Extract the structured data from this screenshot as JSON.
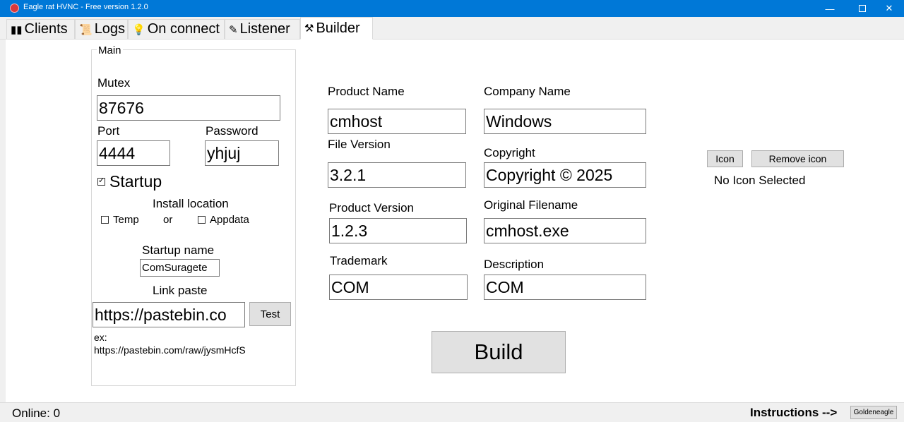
{
  "window": {
    "title": "Eagle rat HVNC - Free version 1.2.0",
    "minimize_glyph": "—",
    "close_glyph": "✕"
  },
  "tabs": [
    {
      "label": "Clients",
      "icon": "▮▮"
    },
    {
      "label": "Logs",
      "icon": "📜"
    },
    {
      "label": "On connect",
      "icon": "💡"
    },
    {
      "label": "Listener",
      "icon": "✎"
    },
    {
      "label": "Builder",
      "icon": "⚒"
    }
  ],
  "main_group": {
    "legend": "Main",
    "mutex_label": "Mutex",
    "mutex_value": "87676",
    "port_label": "Port",
    "port_value": "4444",
    "password_label": "Password",
    "password_value": "yhjuj",
    "startup_label": "Startup",
    "startup_checked": true,
    "install_location_label": "Install location",
    "temp_label": "Temp",
    "or_label": "or",
    "appdata_label": "Appdata",
    "startup_name_label": "Startup name",
    "startup_name_value": "ComSuragete",
    "link_paste_label": "Link paste",
    "link_paste_value": "https://pastebin.co",
    "test_button": "Test",
    "example_prefix": "ex:",
    "example_url": "https://pastebin.com/raw/jysmHcfS"
  },
  "assembly": {
    "product_name_label": "Product Name",
    "product_name_value": "cmhost",
    "company_name_label": "Company Name",
    "company_name_value": "Windows",
    "file_version_label": "File Version",
    "file_version_value": "3.2.1",
    "copyright_label": "Copyright",
    "copyright_value": "Copyright ©  2025",
    "product_version_label": "Product Version",
    "product_version_value": "1.2.3",
    "original_filename_label": "Original Filename",
    "original_filename_value": "cmhost.exe",
    "trademark_label": "Trademark",
    "trademark_value": "COM",
    "description_label": "Description",
    "description_value": "COM"
  },
  "icon_section": {
    "icon_button": "Icon",
    "remove_icon_button": "Remove icon",
    "status": "No Icon Selected"
  },
  "build_button": "Build",
  "statusbar": {
    "online": "Online: 0",
    "instructions": "Instructions -->",
    "goldeneagle_button": "Goldeneagle"
  },
  "colors": {
    "titlebar": "#0078d7",
    "button": "#e1e1e1",
    "tabstrip": "#f0f0f0"
  }
}
